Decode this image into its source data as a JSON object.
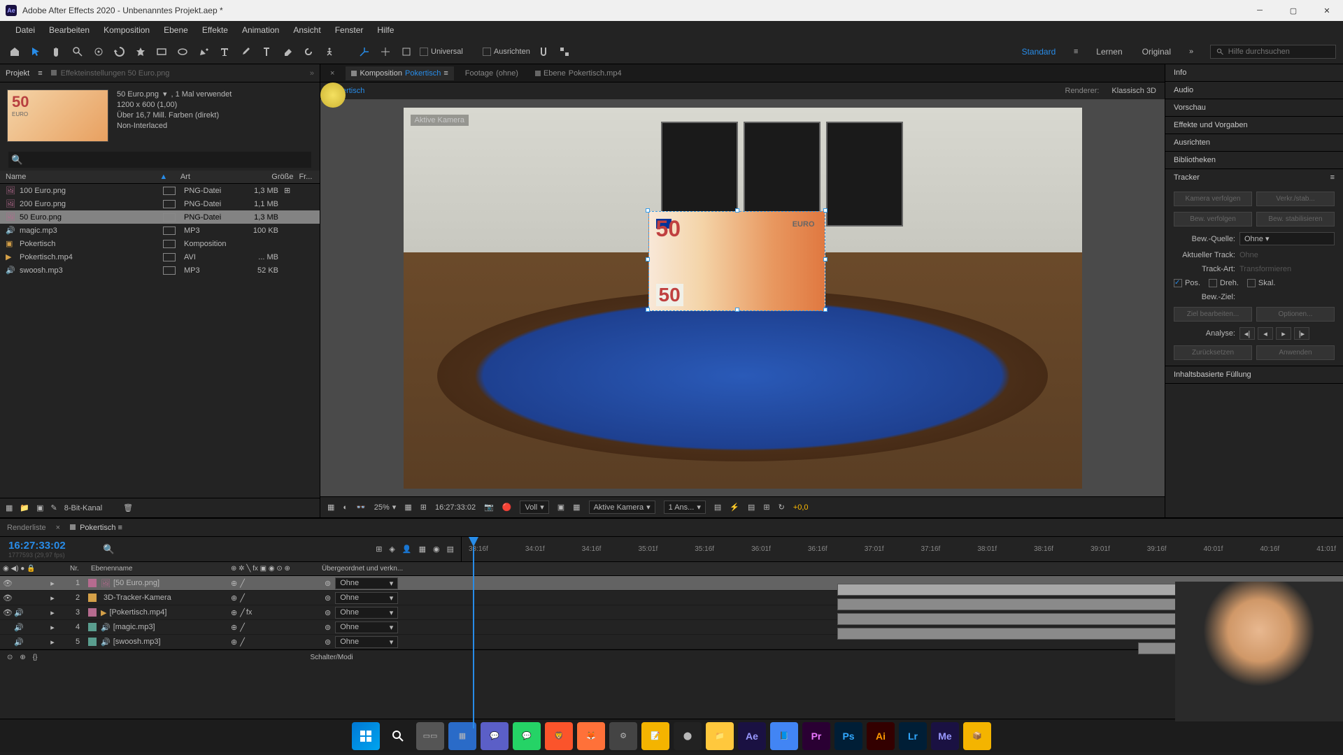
{
  "titlebar": {
    "app_icon": "Ae",
    "title": "Adobe After Effects 2020 - Unbenanntes Projekt.aep *"
  },
  "menu": [
    "Datei",
    "Bearbeiten",
    "Komposition",
    "Ebene",
    "Effekte",
    "Animation",
    "Ansicht",
    "Fenster",
    "Hilfe"
  ],
  "toolbar": {
    "universal": "Universal",
    "ausrichten": "Ausrichten",
    "workspace_active": "Standard",
    "workspace_items": [
      "Lernen",
      "Original"
    ],
    "search_placeholder": "Hilfe durchsuchen"
  },
  "project": {
    "tab_project": "Projekt",
    "tab_settings": "Effekteinstellungen 50 Euro.png",
    "selected_name": "50 Euro.png",
    "selected_usage": ", 1 Mal verwendet",
    "dimensions": "1200 x 600 (1,00)",
    "colors": "Über 16,7 Mill. Farben (direkt)",
    "interlace": "Non-Interlaced",
    "headers": {
      "name": "Name",
      "type": "Art",
      "size": "Größe",
      "fr": "Fr..."
    },
    "rows": [
      {
        "name": "100 Euro.png",
        "type": "PNG-Datei",
        "size": "1,3 MB",
        "icon": "image",
        "extra": true
      },
      {
        "name": "200 Euro.png",
        "type": "PNG-Datei",
        "size": "1,1 MB",
        "icon": "image"
      },
      {
        "name": "50 Euro.png",
        "type": "PNG-Datei",
        "size": "1,3 MB",
        "icon": "image",
        "selected": true
      },
      {
        "name": "magic.mp3",
        "type": "MP3",
        "size": "100 KB",
        "icon": "audio"
      },
      {
        "name": "Pokertisch",
        "type": "Komposition",
        "size": "",
        "icon": "comp"
      },
      {
        "name": "Pokertisch.mp4",
        "type": "AVI",
        "size": "... MB",
        "icon": "video"
      },
      {
        "name": "swoosh.mp3",
        "type": "MP3",
        "size": "52 KB",
        "icon": "audio"
      }
    ],
    "footer_label": "8-Bit-Kanal"
  },
  "comp_tabs": {
    "komposition": "Komposition",
    "comp_name": "Pokertisch",
    "footage": "Footage",
    "footage_none": "(ohne)",
    "ebene": "Ebene",
    "ebene_name": "Pokertisch.mp4"
  },
  "comp_nav": {
    "crumb": "Pokertisch",
    "renderer_label": "Renderer:",
    "renderer_value": "Klassisch 3D"
  },
  "viewer": {
    "camera_label": "Aktive Kamera"
  },
  "viewer_footer": {
    "zoom": "25%",
    "timecode": "16:27:33:02",
    "resolution": "Voll",
    "camera": "Aktive Kamera",
    "views": "1 Ans...",
    "exposure": "+0,0"
  },
  "right_panels": {
    "info": "Info",
    "audio": "Audio",
    "vorschau": "Vorschau",
    "effekte": "Effekte und Vorgaben",
    "ausrichten": "Ausrichten",
    "bibliotheken": "Bibliotheken",
    "tracker": "Tracker",
    "inhalts": "Inhaltsbasierte Füllung"
  },
  "tracker": {
    "btn_kamera": "Kamera verfolgen",
    "btn_verkst": "Verkr./stab...",
    "btn_bew_verf": "Bew. verfolgen",
    "btn_bew_stab": "Bew. stabilisieren",
    "bew_quelle_label": "Bew.-Quelle:",
    "bew_quelle_value": "Ohne",
    "aktueller_label": "Aktueller Track:",
    "aktueller_value": "Ohne",
    "trackart_label": "Track-Art:",
    "trackart_value": "Transformieren",
    "pos": "Pos.",
    "dreh": "Dreh.",
    "skal": "Skal.",
    "bew_ziel": "Bew.-Ziel:",
    "ziel_bearbeiten": "Ziel bearbeiten...",
    "optionen": "Optionen...",
    "analyse": "Analyse:",
    "zurucksetzen": "Zurücksetzen",
    "anwenden": "Anwenden"
  },
  "timeline": {
    "tab_render": "Renderliste",
    "tab_comp": "Pokertisch",
    "timecode": "16:27:33:02",
    "frames": "1777593 (29,97 fps)",
    "headers": {
      "nr": "Nr.",
      "name": "Ebenenname",
      "parent": "Übergeordnet und verkn..."
    },
    "ruler": [
      "33:16f",
      "34:01f",
      "34:16f",
      "35:01f",
      "35:16f",
      "36:01f",
      "36:16f",
      "37:01f",
      "37:16f",
      "38:01f",
      "38:16f",
      "39:01f",
      "39:16f",
      "40:01f",
      "40:16f",
      "41:01f"
    ],
    "layers": [
      {
        "nr": "1",
        "name": "[50 Euro.png]",
        "color": "#b56b8f",
        "parent": "Ohne",
        "icon": "image",
        "eye": true,
        "selected": true
      },
      {
        "nr": "2",
        "name": "3D-Tracker-Kamera",
        "color": "#d4a048",
        "parent": "Ohne",
        "icon": "camera",
        "eye": true
      },
      {
        "nr": "3",
        "name": "[Pokertisch.mp4]",
        "color": "#b56b8f",
        "parent": "Ohne",
        "icon": "video",
        "eye": true,
        "audio": true,
        "fx": true
      },
      {
        "nr": "4",
        "name": "[magic.mp3]",
        "color": "#5a9e8f",
        "parent": "Ohne",
        "icon": "audio",
        "audio": true
      },
      {
        "nr": "5",
        "name": "[swoosh.mp3]",
        "color": "#5a9e8f",
        "parent": "Ohne",
        "icon": "audio",
        "audio": true
      }
    ],
    "footer": "Schalter/Modi"
  }
}
